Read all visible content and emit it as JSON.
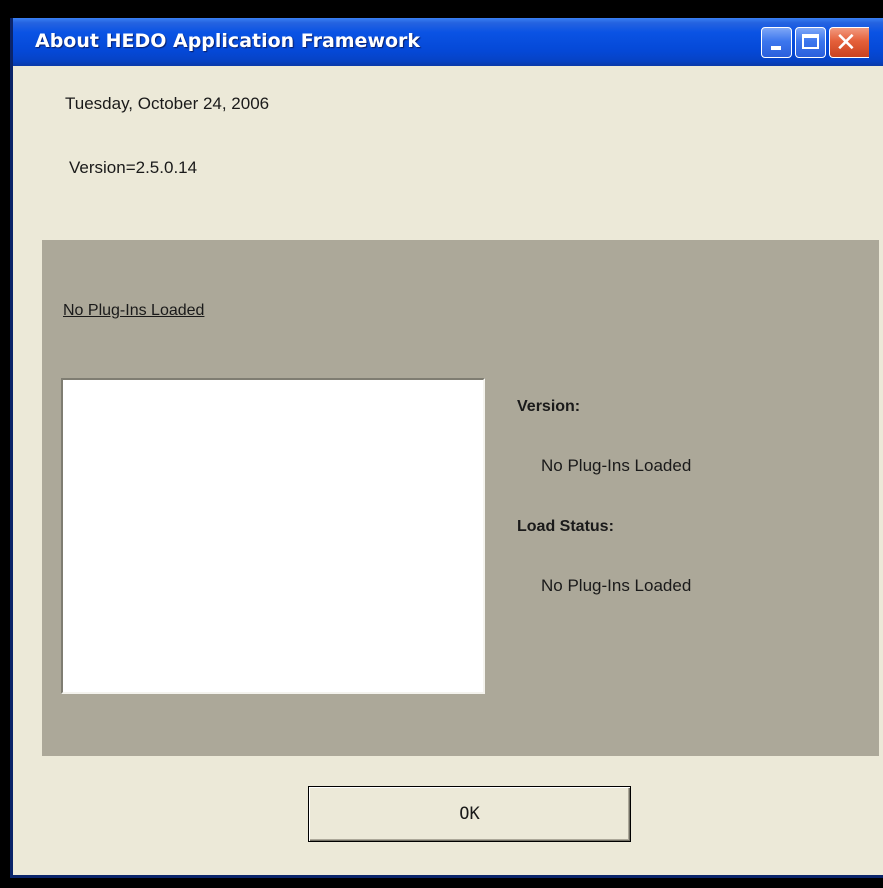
{
  "window": {
    "title": "About HEDO Application Framework",
    "controls": {
      "minimize": "minimize",
      "maximize": "maximize",
      "close": "close"
    }
  },
  "info": {
    "date": "Tuesday, October 24, 2006",
    "version": "Version=2.5.0.14"
  },
  "plugins": {
    "link_label": "No Plug-Ins Loaded",
    "list_items": [],
    "version_heading": "Version:",
    "version_value": "No Plug-Ins Loaded",
    "status_heading": "Load Status:",
    "status_value": "No Plug-Ins Loaded"
  },
  "buttons": {
    "ok_label": "OK"
  },
  "icons": {
    "minimize": "minimize-icon",
    "maximize": "maximize-icon",
    "close": "close-icon"
  },
  "colors": {
    "titlebar": "#0548d6",
    "dialog_background": "#ece9d8",
    "panel_background": "#aca899",
    "close_button": "#e5603a"
  }
}
